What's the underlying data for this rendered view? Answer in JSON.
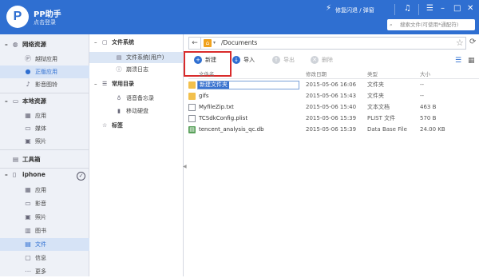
{
  "app": {
    "logo": "P",
    "name": "PP助手",
    "login": "点击登录"
  },
  "topbar": {
    "fix_label": "修复闪退 / 弹窗",
    "search_placeholder": "搜索文件(可使用*通配符)"
  },
  "sidebar": {
    "sections": [
      {
        "label": "网络资源",
        "items": [
          {
            "label": "越狱应用"
          },
          {
            "label": "正版应用"
          },
          {
            "label": "影音图铃"
          }
        ]
      },
      {
        "label": "本地资源",
        "items": [
          {
            "label": "应用"
          },
          {
            "label": "媒体"
          },
          {
            "label": "照片"
          }
        ]
      },
      {
        "label": "工具箱"
      },
      {
        "label": "iphone",
        "items": [
          {
            "label": "应用"
          },
          {
            "label": "影音"
          },
          {
            "label": "照片"
          },
          {
            "label": "图书"
          },
          {
            "label": "文件"
          },
          {
            "label": "信息"
          },
          {
            "label": "更多"
          }
        ]
      }
    ]
  },
  "tree": {
    "filesystem": {
      "label": "文件系统",
      "items": [
        {
          "label": "文件系统(用户)"
        },
        {
          "label": "崩溃日志"
        }
      ]
    },
    "common": {
      "label": "常用目录",
      "items": [
        {
          "label": "语音备忘录"
        },
        {
          "label": "移动硬盘"
        }
      ]
    },
    "tags": {
      "label": "标签"
    }
  },
  "address": {
    "path": "/Documents"
  },
  "toolbar": {
    "new": "新建",
    "import": "导入",
    "export": "导出",
    "delete": "删除"
  },
  "table": {
    "headers": {
      "name": "文件名",
      "date": "修改日期",
      "type": "类型",
      "size": "大小"
    },
    "rows": [
      {
        "name": "新建文件夹",
        "date": "2015-05-06 16:06",
        "type": "文件夹",
        "size": "--",
        "icon": "folder-icon"
      },
      {
        "name": "gifs",
        "date": "2015-05-06 15:43",
        "type": "文件夹",
        "size": "--",
        "icon": "folder-icon"
      },
      {
        "name": "MyfileZip.txt",
        "date": "2015-05-06 15:40",
        "type": "文本文档",
        "size": "463 B",
        "icon": "text-file-icon"
      },
      {
        "name": "TCSdkConfig.plist",
        "date": "2015-05-06 15:39",
        "type": "PLIST 文件",
        "size": "570 B",
        "icon": "plist-file-icon"
      },
      {
        "name": "tencent_analysis_qc.db",
        "date": "2015-05-06 15:39",
        "type": "Data Base File",
        "size": "24.00 KB",
        "icon": "database-file-icon"
      }
    ]
  },
  "colors": {
    "brand": "#2f6fd1",
    "highlight": "#d92b2b",
    "folder": "#f2c04c"
  }
}
